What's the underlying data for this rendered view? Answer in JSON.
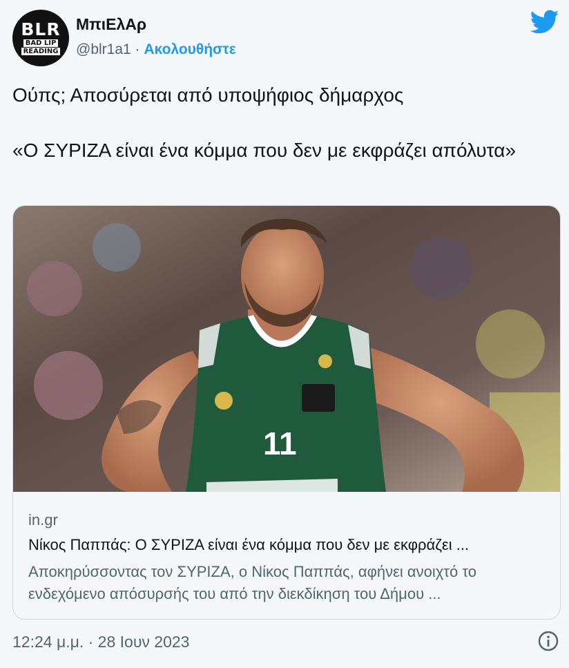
{
  "author": {
    "avatar_text_main": "BLR",
    "avatar_text_line1": "BAD LIP",
    "avatar_text_line2": "READING",
    "display_name": "ΜπιΕλΑρ",
    "handle": "@blr1a1",
    "separator": "·",
    "follow_label": "Ακολουθήστε"
  },
  "icons": {
    "brand": "twitter-bird-icon",
    "info": "info-icon"
  },
  "tweet": {
    "line1": "Ούπς; Αποσύρεται από υποψήφιος δήμαρχος",
    "line2": "«Ο ΣΥΡΙΖΑ είναι ένα κόμμα που δεν με εκφράζει απόλυτα»"
  },
  "card": {
    "image_jersey_number": "11",
    "domain": "in.gr",
    "title": "Νίκος Παππάς: Ο ΣΥΡΙΖΑ είναι ένα κόμμα που δεν με εκφράζει ...",
    "description": "Αποκηρύσσοντας τον ΣΥΡΙΖΑ, ο Νίκος Παππάς, αφήνει ανοιχτό το ενδεχόμενο απόσυρσής του από την διεκδίκηση του Δήμου ..."
  },
  "footer": {
    "timestamp": "12:24 μ.μ. · 28 Ιουν 2023"
  },
  "colors": {
    "accent": "#1d9bf0",
    "background": "#f5f8fa",
    "secondary_text": "#536471",
    "jersey_green": "#1f5a3d"
  }
}
